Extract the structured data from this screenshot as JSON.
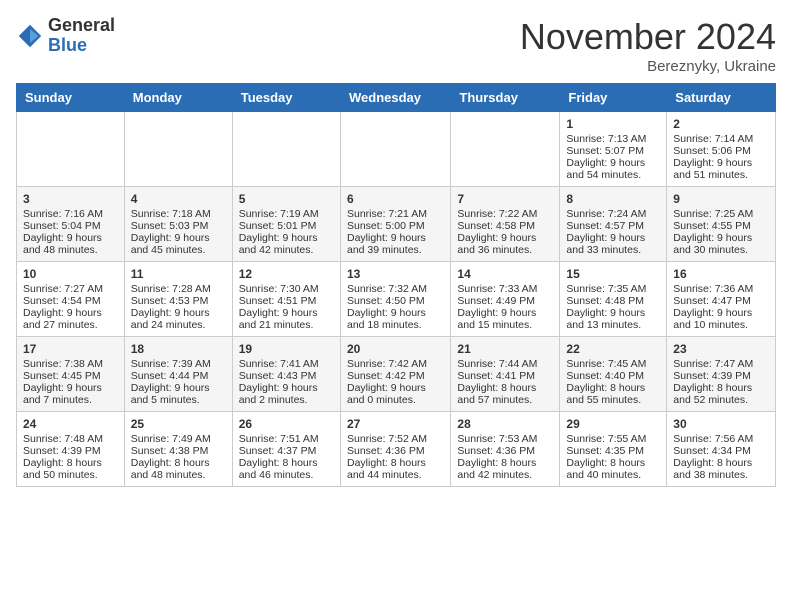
{
  "logo": {
    "general": "General",
    "blue": "Blue"
  },
  "title": "November 2024",
  "subtitle": "Bereznyky, Ukraine",
  "days": [
    "Sunday",
    "Monday",
    "Tuesday",
    "Wednesday",
    "Thursday",
    "Friday",
    "Saturday"
  ],
  "weeks": [
    [
      {
        "day": "",
        "content": ""
      },
      {
        "day": "",
        "content": ""
      },
      {
        "day": "",
        "content": ""
      },
      {
        "day": "",
        "content": ""
      },
      {
        "day": "",
        "content": ""
      },
      {
        "day": "1",
        "content": "Sunrise: 7:13 AM\nSunset: 5:07 PM\nDaylight: 9 hours\nand 54 minutes."
      },
      {
        "day": "2",
        "content": "Sunrise: 7:14 AM\nSunset: 5:06 PM\nDaylight: 9 hours\nand 51 minutes."
      }
    ],
    [
      {
        "day": "3",
        "content": "Sunrise: 7:16 AM\nSunset: 5:04 PM\nDaylight: 9 hours\nand 48 minutes."
      },
      {
        "day": "4",
        "content": "Sunrise: 7:18 AM\nSunset: 5:03 PM\nDaylight: 9 hours\nand 45 minutes."
      },
      {
        "day": "5",
        "content": "Sunrise: 7:19 AM\nSunset: 5:01 PM\nDaylight: 9 hours\nand 42 minutes."
      },
      {
        "day": "6",
        "content": "Sunrise: 7:21 AM\nSunset: 5:00 PM\nDaylight: 9 hours\nand 39 minutes."
      },
      {
        "day": "7",
        "content": "Sunrise: 7:22 AM\nSunset: 4:58 PM\nDaylight: 9 hours\nand 36 minutes."
      },
      {
        "day": "8",
        "content": "Sunrise: 7:24 AM\nSunset: 4:57 PM\nDaylight: 9 hours\nand 33 minutes."
      },
      {
        "day": "9",
        "content": "Sunrise: 7:25 AM\nSunset: 4:55 PM\nDaylight: 9 hours\nand 30 minutes."
      }
    ],
    [
      {
        "day": "10",
        "content": "Sunrise: 7:27 AM\nSunset: 4:54 PM\nDaylight: 9 hours\nand 27 minutes."
      },
      {
        "day": "11",
        "content": "Sunrise: 7:28 AM\nSunset: 4:53 PM\nDaylight: 9 hours\nand 24 minutes."
      },
      {
        "day": "12",
        "content": "Sunrise: 7:30 AM\nSunset: 4:51 PM\nDaylight: 9 hours\nand 21 minutes."
      },
      {
        "day": "13",
        "content": "Sunrise: 7:32 AM\nSunset: 4:50 PM\nDaylight: 9 hours\nand 18 minutes."
      },
      {
        "day": "14",
        "content": "Sunrise: 7:33 AM\nSunset: 4:49 PM\nDaylight: 9 hours\nand 15 minutes."
      },
      {
        "day": "15",
        "content": "Sunrise: 7:35 AM\nSunset: 4:48 PM\nDaylight: 9 hours\nand 13 minutes."
      },
      {
        "day": "16",
        "content": "Sunrise: 7:36 AM\nSunset: 4:47 PM\nDaylight: 9 hours\nand 10 minutes."
      }
    ],
    [
      {
        "day": "17",
        "content": "Sunrise: 7:38 AM\nSunset: 4:45 PM\nDaylight: 9 hours\nand 7 minutes."
      },
      {
        "day": "18",
        "content": "Sunrise: 7:39 AM\nSunset: 4:44 PM\nDaylight: 9 hours\nand 5 minutes."
      },
      {
        "day": "19",
        "content": "Sunrise: 7:41 AM\nSunset: 4:43 PM\nDaylight: 9 hours\nand 2 minutes."
      },
      {
        "day": "20",
        "content": "Sunrise: 7:42 AM\nSunset: 4:42 PM\nDaylight: 9 hours\nand 0 minutes."
      },
      {
        "day": "21",
        "content": "Sunrise: 7:44 AM\nSunset: 4:41 PM\nDaylight: 8 hours\nand 57 minutes."
      },
      {
        "day": "22",
        "content": "Sunrise: 7:45 AM\nSunset: 4:40 PM\nDaylight: 8 hours\nand 55 minutes."
      },
      {
        "day": "23",
        "content": "Sunrise: 7:47 AM\nSunset: 4:39 PM\nDaylight: 8 hours\nand 52 minutes."
      }
    ],
    [
      {
        "day": "24",
        "content": "Sunrise: 7:48 AM\nSunset: 4:39 PM\nDaylight: 8 hours\nand 50 minutes."
      },
      {
        "day": "25",
        "content": "Sunrise: 7:49 AM\nSunset: 4:38 PM\nDaylight: 8 hours\nand 48 minutes."
      },
      {
        "day": "26",
        "content": "Sunrise: 7:51 AM\nSunset: 4:37 PM\nDaylight: 8 hours\nand 46 minutes."
      },
      {
        "day": "27",
        "content": "Sunrise: 7:52 AM\nSunset: 4:36 PM\nDaylight: 8 hours\nand 44 minutes."
      },
      {
        "day": "28",
        "content": "Sunrise: 7:53 AM\nSunset: 4:36 PM\nDaylight: 8 hours\nand 42 minutes."
      },
      {
        "day": "29",
        "content": "Sunrise: 7:55 AM\nSunset: 4:35 PM\nDaylight: 8 hours\nand 40 minutes."
      },
      {
        "day": "30",
        "content": "Sunrise: 7:56 AM\nSunset: 4:34 PM\nDaylight: 8 hours\nand 38 minutes."
      }
    ]
  ]
}
